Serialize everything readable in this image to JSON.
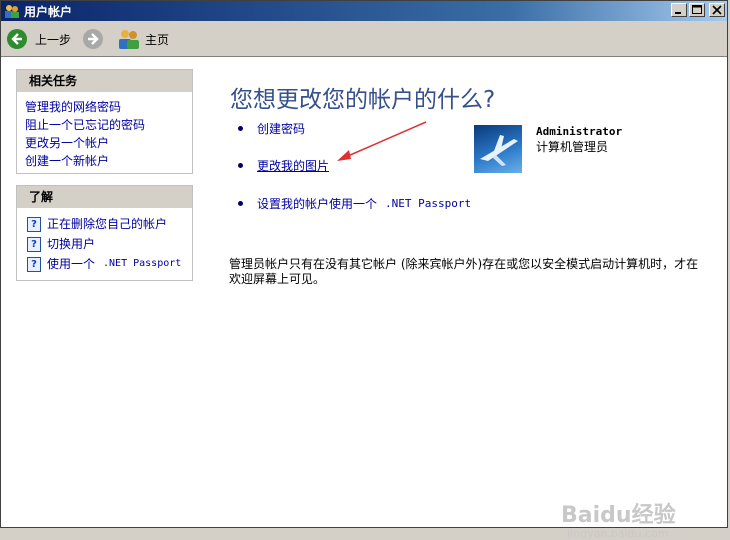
{
  "window": {
    "title": "用户帐户"
  },
  "toolbar": {
    "back_label": "上一步",
    "home_label": "主页"
  },
  "sidebar": {
    "related_tasks": {
      "header": "相关任务",
      "items": [
        {
          "label": "管理我的网络密码"
        },
        {
          "label": "阻止一个已忘记的密码"
        },
        {
          "label": "更改另一个帐户"
        },
        {
          "label": "创建一个新帐户"
        }
      ]
    },
    "learn": {
      "header": "了解",
      "items": [
        {
          "label": "正在删除您自己的帐户"
        },
        {
          "label": "切换用户"
        },
        {
          "label": "使用一个",
          "label_mono": ".NET Passport"
        }
      ]
    }
  },
  "main": {
    "heading": "您想更改您的帐户的什么?",
    "tasks": [
      {
        "label": "创建密码"
      },
      {
        "label": "更改我的图片"
      },
      {
        "label": "设置我的帐户使用一个",
        "label_mono": ".NET Passport"
      }
    ],
    "account": {
      "name": "Administrator",
      "role": "计算机管理员"
    },
    "note": "管理员帐户只有在没有其它帐户 (除来宾帐户外)存在或您以安全模式启动计算机时，才在欢迎屏幕上可见。"
  },
  "watermark": {
    "text": "Baidu经验",
    "sub": "jingyan.baidu.com"
  },
  "colors": {
    "titlebar": "#0a246a",
    "link": "#0000a0",
    "heading": "#36508c",
    "annotation_arrow": "#e03030"
  }
}
